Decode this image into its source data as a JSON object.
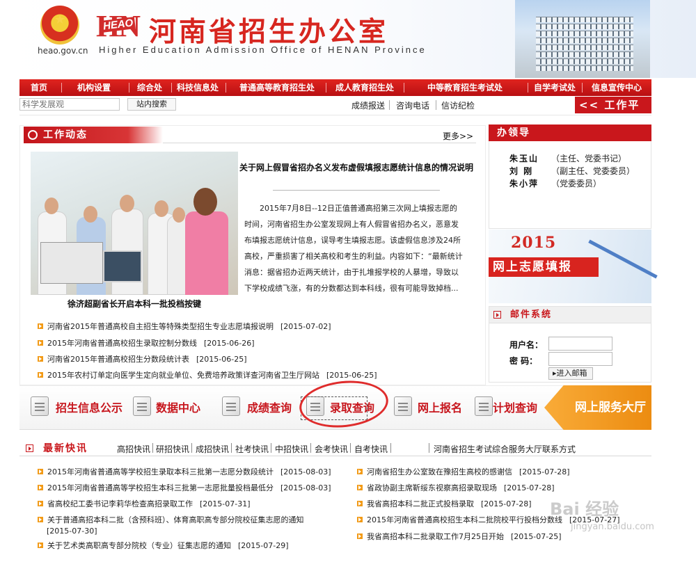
{
  "header": {
    "domain": "heao.gov.cn",
    "logo_mark": "HN",
    "logo_small": "HEAO",
    "title": "河南省招生办公室",
    "subtitle": "Higher Education Admission Office of HENAN Province"
  },
  "nav": {
    "items": [
      "首页",
      "机构设置",
      "综合处",
      "科技信息处",
      "普通高等教育招生处",
      "成人教育招生处",
      "中等教育招生考试处",
      "自学考试处",
      "信息宣传中心"
    ]
  },
  "search": {
    "placeholder": "科学发展观",
    "button": "站内搜索",
    "links": [
      "成绩报送",
      "咨询电话",
      "信访纪检"
    ],
    "platform": "<< 工作平台"
  },
  "work_news": {
    "header": "工作动态",
    "more": "更多>>",
    "photo_caption": "徐济超副省长开启本科一批投档按键",
    "article_title": "关于网上假冒省招办名义发布虚假填报志愿统计信息的情况说明",
    "article_body": "2015年7月8日--12日正值普通高招第三次网上填报志愿的时间，河南省招生办公室发现网上有人假冒省招办名义，恶意发布填报志愿统计信息，误导考生填报志愿。该虚假信息涉及24所高校，严重损害了相关高校和考生的利益。内容如下：“最新统计消息：据省招办近两天统计，由于扎堆报学校的人暴增，导致以下学校成绩飞涨，有的分数都达到本科线，很有可能导致掉档...",
    "items": [
      {
        "text": "河南省2015年普通高校自主招生等特殊类型招生专业志愿填报说明",
        "date": "[2015-07-02]"
      },
      {
        "text": "2015年河南省普通高校招生录取控制分数线",
        "date": "[2015-06-26]"
      },
      {
        "text": "河南省2015年普通高校招生分数段统计表",
        "date": "[2015-06-25]"
      },
      {
        "text": "2015年农村订单定向医学生定向就业单位、免费培养政策详查河南省卫生厅网站",
        "date": "[2015-06-25]"
      }
    ]
  },
  "leaders": {
    "header": "办领导",
    "people": [
      {
        "name": "朱玉山",
        "role": "（主任、党委书记）"
      },
      {
        "name": "刘  刚",
        "role": "（副主任、党委委员）"
      },
      {
        "name": "朱小萍",
        "role": "（党委委员）"
      }
    ]
  },
  "banner": {
    "year": "2015",
    "text": "网上志愿填报"
  },
  "mail": {
    "header": "邮件系统",
    "username_label": "用户名：",
    "password_label": "密  码：",
    "login": "进入邮箱"
  },
  "services": {
    "items": [
      "招生信息公示",
      "数据中心",
      "成绩查询",
      "录取查询",
      "网上报名",
      "计划查询"
    ],
    "hall": "网上服务大厅"
  },
  "latest": {
    "title": "最新快讯",
    "categories": [
      "高招快讯",
      "研招快讯",
      "成招快讯",
      "社考快讯",
      "中招快讯",
      "会考快讯",
      "自考快讯"
    ],
    "hall_link": "河南省招生考试综合服务大厅联系方式",
    "left_items": [
      {
        "text": "2015年河南省普通高等学校招生录取本科三批第一志愿分数段统计",
        "date": "[2015-08-03]"
      },
      {
        "text": "2015年河南省普通高等学校招生本科三批第一志愿批量投档最低分",
        "date": "[2015-08-03]"
      },
      {
        "text": "省高校纪工委书记李莉华检查高招录取工作",
        "date": "[2015-07-31]"
      },
      {
        "text": "关于普通高招本科二批（含预科班）、体育高职高专部分院校征集志愿的通知",
        "date": "[2015-07-30]"
      },
      {
        "text": "关于艺术类高职高专部分院校（专业）征集志愿的通知",
        "date": "[2015-07-29]"
      }
    ],
    "right_items": [
      {
        "text": "河南省招生办公室致在豫招生高校的感谢信",
        "date": "[2015-07-28]"
      },
      {
        "text": "省政协副主席靳绥东视察高招录取现场",
        "date": "[2015-07-28]"
      },
      {
        "text": "我省高招本科二批正式投档录取",
        "date": "[2015-07-28]"
      },
      {
        "text": "2015年河南省普通高校招生本科二批院校平行投档分数线",
        "date": "[2015-07-27]"
      },
      {
        "text": "我省高招本科二批录取工作7月25日开始",
        "date": "[2015-07-25]"
      }
    ]
  },
  "watermark": {
    "text": "Bai 经验",
    "url": "jingyan.baidu.com"
  }
}
